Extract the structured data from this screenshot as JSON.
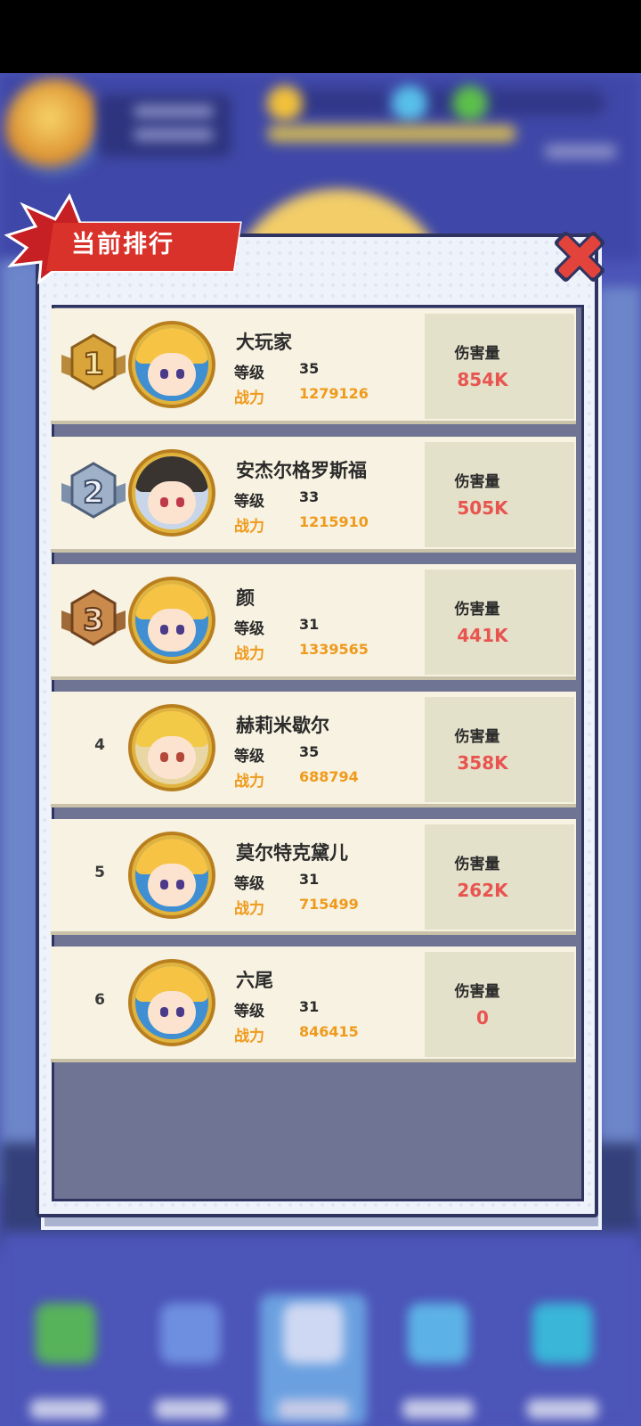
{
  "dialog": {
    "title": "当前排行",
    "close_icon": "close-x-icon"
  },
  "labels": {
    "level": "等级",
    "power": "战力",
    "damage": "伤害量"
  },
  "rankings": [
    {
      "rank": "1",
      "medal": "gold-medal-icon",
      "name": "大玩家",
      "level": "35",
      "power": "1279126",
      "damage": "854K"
    },
    {
      "rank": "2",
      "medal": "silver-medal-icon",
      "name": "安杰尔格罗斯福",
      "level": "33",
      "power": "1215910",
      "damage": "505K"
    },
    {
      "rank": "3",
      "medal": "bronze-medal-icon",
      "name": "颜",
      "level": "31",
      "power": "1339565",
      "damage": "441K"
    },
    {
      "rank": "4",
      "medal": "",
      "name": "赫莉米歇尔",
      "level": "35",
      "power": "688794",
      "damage": "358K"
    },
    {
      "rank": "5",
      "medal": "",
      "name": "莫尔特克黛儿",
      "level": "31",
      "power": "715499",
      "damage": "262K"
    },
    {
      "rank": "6",
      "medal": "",
      "name": "六尾",
      "level": "31",
      "power": "846415",
      "damage": "0"
    }
  ],
  "colors": {
    "accent_red": "#d9322b",
    "power_orange": "#ef9a1d",
    "damage_red": "#e8544f",
    "gold": "#d9a53a",
    "silver": "#9eb1c9",
    "bronze": "#c98a4b"
  }
}
